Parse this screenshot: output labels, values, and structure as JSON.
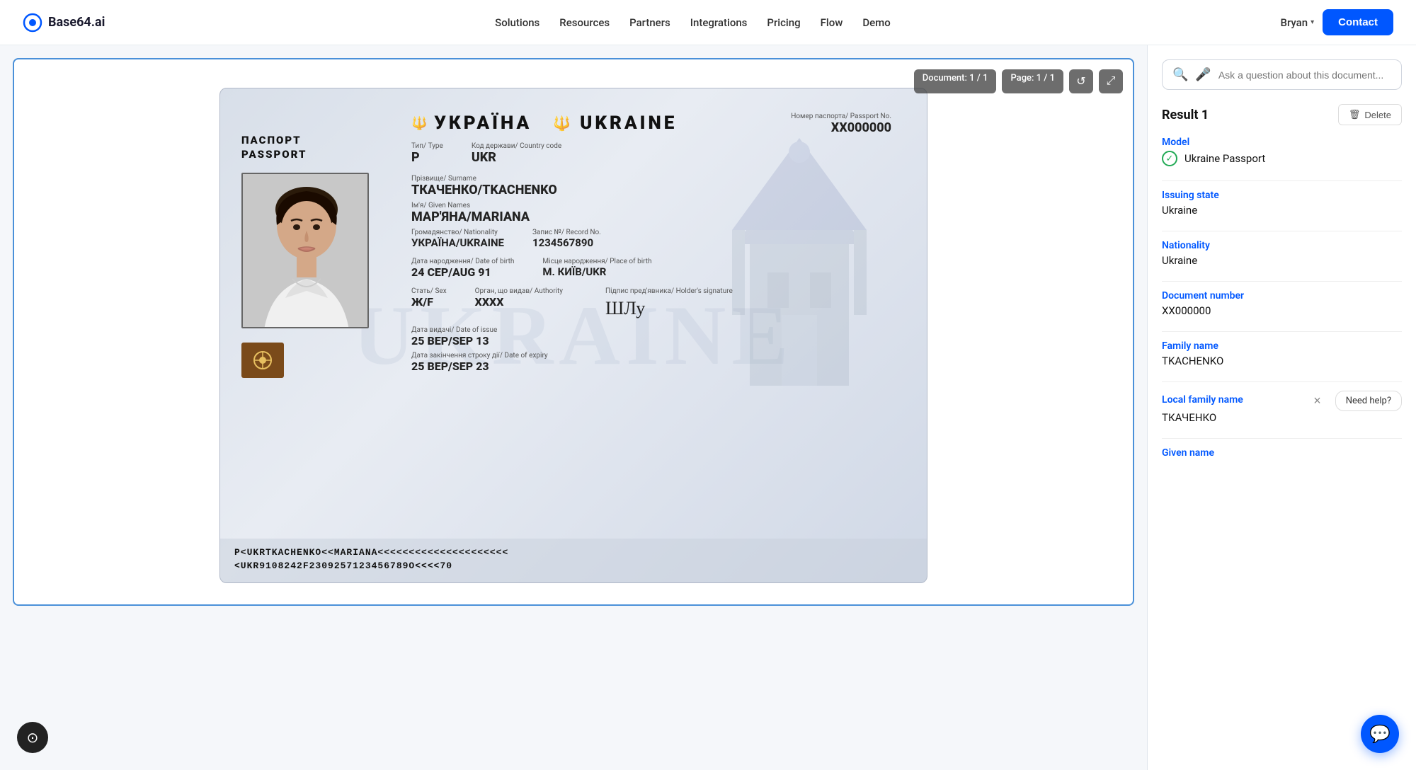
{
  "nav": {
    "logo_text": "Base64.ai",
    "links": [
      "Solutions",
      "Resources",
      "Partners",
      "Integrations",
      "Pricing",
      "Flow",
      "Demo"
    ],
    "user": "Bryan",
    "contact_label": "Contact"
  },
  "doc_toolbar": {
    "document_badge": "Document: 1 / 1",
    "page_badge": "Page: 1 / 1",
    "refresh_icon": "↺",
    "fullscreen_icon": "⤢"
  },
  "passport": {
    "country_code": "UKRAINE",
    "country_native": "УКРАЇНА",
    "type_label": "Тип/ Type",
    "type_value": "Р",
    "country_code_label": "Код держави/ Country code",
    "country_code_value": "UKR",
    "passport_no_label": "Номер паспорта/ Passport No.",
    "passport_no_value": "XX000000",
    "surname_label": "Прізвище/ Surname",
    "surname_value": "ТКАЧЕНКО/TKACHENKO",
    "given_names_label": "Ім'я/ Given Names",
    "given_names_value": "МАР'ЯНА/MARIANA",
    "nationality_label": "Громадянство/ Nationality",
    "nationality_value": "УКРАЇНА/UKRAINE",
    "record_no_label": "Запис №/ Record No.",
    "record_no_value": "1234567890",
    "dob_label": "Дата народження/ Date of birth",
    "dob_value": "24 СЕР/AUG 91",
    "pob_label": "Місце народження/ Place of birth",
    "pob_value": "М. КИЇВ/UKR",
    "sex_label": "Стать/ Sex",
    "sex_value": "Ж/F",
    "authority_label": "Орган, що видав/ Authority",
    "authority_value": "XXXX",
    "doi_label": "Дата видачі/ Date of issue",
    "doi_value": "25 ВЕР/SEP 13",
    "doe_label": "Дата закінчення строку дії/ Date of expiry",
    "doe_value": "25 ВЕР/SEP 23",
    "signature_label": "Підпис пред'явника/ Holder's signature",
    "header_left": "ПАСПОРТ\nPASSPORT",
    "mrz_line1": "P<UKRTKACHENKO<<MARIANA<<<<<<<<<<<<<<<<<<<<<",
    "mrz_line2": "<UKR9108242F2309257123456789O<<<<70"
  },
  "results": {
    "search_placeholder": "Ask a question about this document...",
    "result_title": "Result 1",
    "delete_label": "Delete",
    "model_label": "Model",
    "model_value": "Ukraine Passport",
    "issuing_state_label": "Issuing state",
    "issuing_state_value": "Ukraine",
    "nationality_label": "Nationality",
    "nationality_value": "Ukraine",
    "document_number_label": "Document number",
    "document_number_value": "XX000000",
    "family_name_label": "Family name",
    "family_name_value": "TKACHENKO",
    "local_family_name_label": "Local family name",
    "local_family_name_value": "ТКАЧЕНКО",
    "given_name_label": "Given name"
  },
  "chat": {
    "need_help_label": "Need help?",
    "close_label": "×"
  },
  "a11y": {
    "icon": "⊙"
  }
}
